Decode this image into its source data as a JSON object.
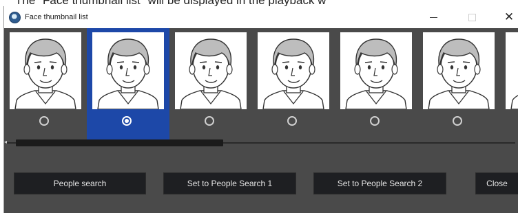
{
  "caption": "The \"Face thumbnail list\" will be displayed in the playback w",
  "window": {
    "title": "Face thumbnail list",
    "icon": "app-globe-icon",
    "controls": {
      "minimize": "—",
      "maximize": "☐",
      "close": "✕"
    }
  },
  "thumbnails": [
    {
      "selected": false
    },
    {
      "selected": true
    },
    {
      "selected": false
    },
    {
      "selected": false
    },
    {
      "selected": false
    },
    {
      "selected": false
    },
    {
      "selected": false
    }
  ],
  "buttons": {
    "people_search": "People search",
    "set_people_search_1": "Set to People Search 1",
    "set_people_search_2": "Set to People Search 2",
    "close": "Close"
  },
  "colors": {
    "window_bg": "#4a4a4a",
    "selected_bg": "#1d48a8",
    "button_bg": "#1e1f22",
    "button_text": "#e6e6e6"
  }
}
